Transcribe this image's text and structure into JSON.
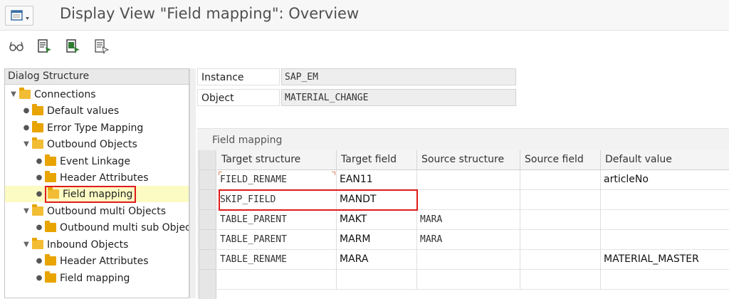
{
  "window": {
    "title": "Display View \"Field mapping\": Overview"
  },
  "toolbar": {
    "icons": [
      "glasses-icon",
      "table-view-icon",
      "table-edit-icon",
      "table-select-icon"
    ]
  },
  "tree": {
    "header": "Dialog Structure",
    "items": [
      {
        "label": "Connections",
        "level": 0,
        "expanded": true
      },
      {
        "label": "Default values",
        "level": 1
      },
      {
        "label": "Error Type Mapping",
        "level": 1
      },
      {
        "label": "Outbound  Objects",
        "level": 1,
        "expanded": true
      },
      {
        "label": "Event Linkage",
        "level": 2
      },
      {
        "label": "Header Attributes",
        "level": 2
      },
      {
        "label": "Field mapping",
        "level": 2,
        "selected": true
      },
      {
        "label": "Outbound multi Objects",
        "level": 1,
        "expanded": true
      },
      {
        "label": "Outbound multi sub Objects",
        "level": 2
      },
      {
        "label": "Inbound Objects",
        "level": 1,
        "expanded": true
      },
      {
        "label": "Header Attributes",
        "level": 2
      },
      {
        "label": "Field mapping",
        "level": 2
      }
    ]
  },
  "header_fields": {
    "instance_label": "Instance",
    "instance_value": "SAP_EM",
    "object_label": "Object",
    "object_value": "MATERIAL_CHANGE"
  },
  "field_mapping": {
    "title": "Field mapping",
    "columns": [
      "Target structure",
      "Target field",
      "Source structure",
      "Source field",
      "Default value"
    ],
    "rows": [
      [
        "FIELD_RENAME",
        "EAN11",
        "",
        "",
        "articleNo"
      ],
      [
        "SKIP_FIELD",
        "MANDT",
        "",
        "",
        ""
      ],
      [
        "TABLE_PARENT",
        "MAKT",
        "MARA",
        "",
        ""
      ],
      [
        "TABLE_PARENT",
        "MARM",
        "MARA",
        "",
        ""
      ],
      [
        "TABLE_RENAME",
        "MARA",
        "",
        "",
        "MATERIAL_MASTER"
      ]
    ]
  },
  "colors": {
    "highlight": "#e01b1b",
    "folder": "#e8a400",
    "selected_row": "#fbfbc3"
  }
}
